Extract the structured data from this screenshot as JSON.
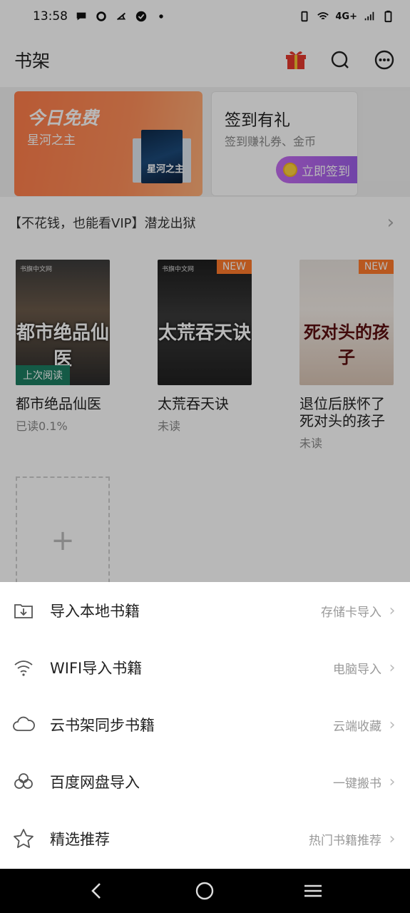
{
  "statusbar": {
    "time": "13:58",
    "network": "4G+"
  },
  "header": {
    "title": "书架",
    "icons": [
      "gift-icon",
      "search-icon",
      "more-icon"
    ]
  },
  "banner_free": {
    "title": "今日免费",
    "book": "星河之主",
    "cover_text": "星河之主"
  },
  "banner_sign": {
    "title": "签到有礼",
    "subtitle": "签到赚礼券、金币",
    "button": "立即签到"
  },
  "promo": {
    "text": "【不花钱，也能看VIP】潜龙出狱"
  },
  "books": [
    {
      "title": "都市绝品仙医",
      "progress": "已读0.1%",
      "cover_title": "都市绝品仙医",
      "badge": "上次阅读",
      "brand": "书旗中文网"
    },
    {
      "title": "太荒吞天诀",
      "progress": "未读",
      "cover_title": "太荒吞天诀",
      "badge": "NEW",
      "brand": "书旗中文网"
    },
    {
      "title": "退位后朕怀了死对头的孩子",
      "progress": "未读",
      "cover_title": "死对头的孩子",
      "badge": "NEW"
    }
  ],
  "add_book": {
    "symbol": "+"
  },
  "sheet": {
    "rows": [
      {
        "icon": "import-icon",
        "label": "导入本地书籍",
        "hint": "存储卡导入"
      },
      {
        "icon": "wifi-icon",
        "label": "WIFI导入书籍",
        "hint": "电脑导入"
      },
      {
        "icon": "cloud-icon",
        "label": "云书架同步书籍",
        "hint": "云端收藏"
      },
      {
        "icon": "baidu-pan-icon",
        "label": "百度网盘导入",
        "hint": "一键搬书"
      },
      {
        "icon": "star-icon",
        "label": "精选推荐",
        "hint": "热门书籍推荐"
      }
    ]
  },
  "colors": {
    "accent_orange": "#ff7d4a",
    "sign_purple": "#9c5ee8",
    "last_read_green": "#1d7d62"
  }
}
